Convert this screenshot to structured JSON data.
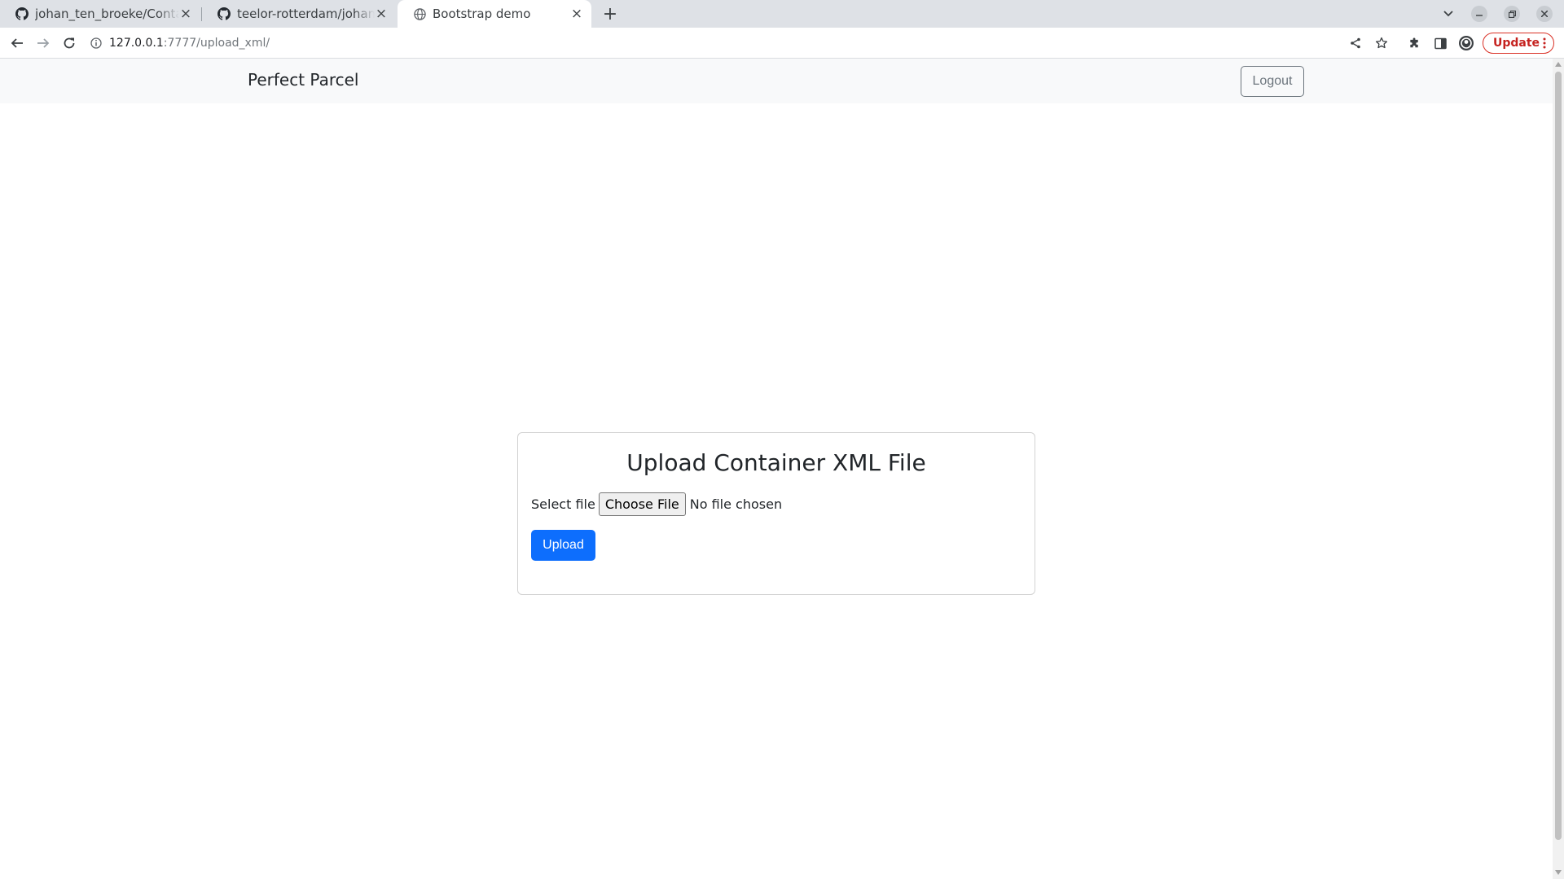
{
  "browser": {
    "tabs": [
      {
        "title": "johan_ten_broeke/Contai",
        "favicon": "github-icon",
        "active": false
      },
      {
        "title": "teelor-rotterdam/johan_t",
        "favicon": "github-icon",
        "active": false
      },
      {
        "title": "Bootstrap demo",
        "favicon": "globe-icon",
        "active": true
      }
    ],
    "address": {
      "host": "127.0.0.1",
      "path": ":7777/upload_xml/"
    },
    "update_label": "Update"
  },
  "navbar": {
    "brand": "Perfect Parcel",
    "logout_label": "Logout"
  },
  "upload_card": {
    "title": "Upload Container XML File",
    "file_label": "Select file",
    "choose_file_label": "Choose File",
    "file_status": "No file chosen",
    "submit_label": "Upload"
  },
  "colors": {
    "primary": "#0d6efd",
    "secondary": "#6c757d",
    "navbar_bg": "#f8f9fa",
    "update_red": "#d93025"
  }
}
